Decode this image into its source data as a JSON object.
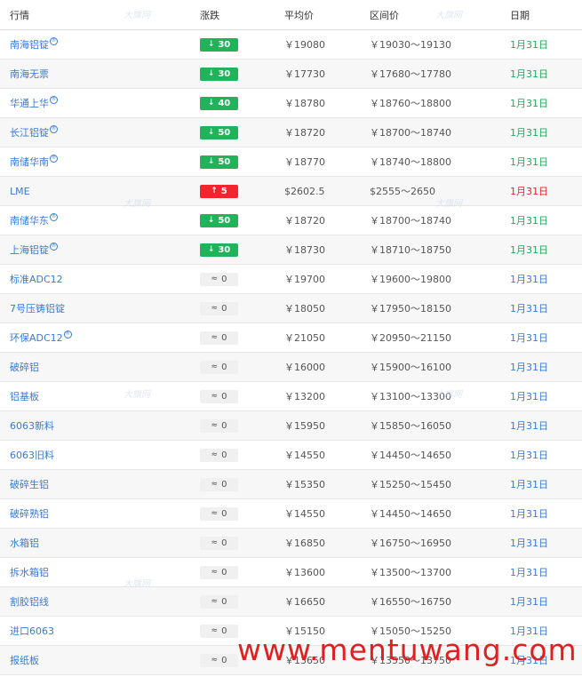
{
  "header": {
    "name": "行情",
    "change": "涨跌",
    "avg": "平均价",
    "range": "区间价",
    "date": "日期"
  },
  "rows": [
    {
      "name": "南海铝锭",
      "mark": true,
      "dir": "down",
      "change": "30",
      "avg": "￥19080",
      "range": "￥19030～19130",
      "date": "1月31日",
      "date_color": "green"
    },
    {
      "name": "南海无票",
      "mark": false,
      "dir": "down",
      "change": "30",
      "avg": "￥17730",
      "range": "￥17680～17780",
      "date": "1月31日",
      "date_color": "green"
    },
    {
      "name": "华通上华",
      "mark": true,
      "dir": "down",
      "change": "40",
      "avg": "￥18780",
      "range": "￥18760～18800",
      "date": "1月31日",
      "date_color": "green"
    },
    {
      "name": "长江铝锭",
      "mark": true,
      "dir": "down",
      "change": "50",
      "avg": "￥18720",
      "range": "￥18700～18740",
      "date": "1月31日",
      "date_color": "green"
    },
    {
      "name": "南储华南",
      "mark": true,
      "dir": "down",
      "change": "50",
      "avg": "￥18770",
      "range": "￥18740～18800",
      "date": "1月31日",
      "date_color": "green"
    },
    {
      "name": "LME",
      "mark": false,
      "dir": "up",
      "change": "5",
      "avg": "$2602.5",
      "range": "$2555～2650",
      "date": "1月31日",
      "date_color": "red"
    },
    {
      "name": "南储华东",
      "mark": true,
      "dir": "down",
      "change": "50",
      "avg": "￥18720",
      "range": "￥18700～18740",
      "date": "1月31日",
      "date_color": "green"
    },
    {
      "name": "上海铝锭",
      "mark": true,
      "dir": "down",
      "change": "30",
      "avg": "￥18730",
      "range": "￥18710～18750",
      "date": "1月31日",
      "date_color": "green"
    },
    {
      "name": "标准ADC12",
      "mark": false,
      "dir": "flat",
      "change": "0",
      "avg": "￥19700",
      "range": "￥19600～19800",
      "date": "1月31日",
      "date_color": "blue"
    },
    {
      "name": "7号压铸铝锭",
      "mark": false,
      "dir": "flat",
      "change": "0",
      "avg": "￥18050",
      "range": "￥17950～18150",
      "date": "1月31日",
      "date_color": "blue"
    },
    {
      "name": "环保ADC12",
      "mark": true,
      "dir": "flat",
      "change": "0",
      "avg": "￥21050",
      "range": "￥20950～21150",
      "date": "1月31日",
      "date_color": "blue"
    },
    {
      "name": "破碎铝",
      "mark": false,
      "dir": "flat",
      "change": "0",
      "avg": "￥16000",
      "range": "￥15900～16100",
      "date": "1月31日",
      "date_color": "blue"
    },
    {
      "name": "铝基板",
      "mark": false,
      "dir": "flat",
      "change": "0",
      "avg": "￥13200",
      "range": "￥13100～13300",
      "date": "1月31日",
      "date_color": "blue"
    },
    {
      "name": "6063新料",
      "mark": false,
      "dir": "flat",
      "change": "0",
      "avg": "￥15950",
      "range": "￥15850～16050",
      "date": "1月31日",
      "date_color": "blue"
    },
    {
      "name": "6063旧料",
      "mark": false,
      "dir": "flat",
      "change": "0",
      "avg": "￥14550",
      "range": "￥14450～14650",
      "date": "1月31日",
      "date_color": "blue"
    },
    {
      "name": "破碎生铝",
      "mark": false,
      "dir": "flat",
      "change": "0",
      "avg": "￥15350",
      "range": "￥15250～15450",
      "date": "1月31日",
      "date_color": "blue"
    },
    {
      "name": "破碎熟铝",
      "mark": false,
      "dir": "flat",
      "change": "0",
      "avg": "￥14550",
      "range": "￥14450～14650",
      "date": "1月31日",
      "date_color": "blue"
    },
    {
      "name": "水箱铝",
      "mark": false,
      "dir": "flat",
      "change": "0",
      "avg": "￥16850",
      "range": "￥16750～16950",
      "date": "1月31日",
      "date_color": "blue"
    },
    {
      "name": "拆水箱铝",
      "mark": false,
      "dir": "flat",
      "change": "0",
      "avg": "￥13600",
      "range": "￥13500～13700",
      "date": "1月31日",
      "date_color": "blue"
    },
    {
      "name": "割胶铝线",
      "mark": false,
      "dir": "flat",
      "change": "0",
      "avg": "￥16650",
      "range": "￥16550～16750",
      "date": "1月31日",
      "date_color": "blue"
    },
    {
      "name": "进口6063",
      "mark": false,
      "dir": "flat",
      "change": "0",
      "avg": "￥15150",
      "range": "￥15050～15250",
      "date": "1月31日",
      "date_color": "blue"
    },
    {
      "name": "报纸板",
      "mark": false,
      "dir": "flat",
      "change": "0",
      "avg": "￥13650",
      "range": "￥13550～13750",
      "date": "1月31日",
      "date_color": "blue"
    }
  ],
  "watermark": "大旗网",
  "site_watermark": "www.mentuwang.com",
  "colors": {
    "down": "#20b35a",
    "up": "#f0262e",
    "flat": "#f0f0f0",
    "link": "#3b7bd1"
  }
}
